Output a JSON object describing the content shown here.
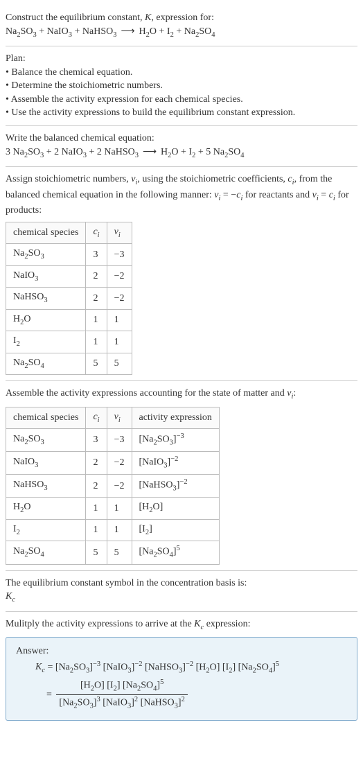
{
  "intro": {
    "line1": "Construct the equilibrium constant, K, expression for:",
    "equation": "Na₂SO₃ + NaIO₃ + NaHSO₃  ⟶  H₂O + I₂ + Na₂SO₄"
  },
  "plan": {
    "heading": "Plan:",
    "items": [
      "Balance the chemical equation.",
      "Determine the stoichiometric numbers.",
      "Assemble the activity expression for each chemical species.",
      "Use the activity expressions to build the equilibrium constant expression."
    ]
  },
  "balanced": {
    "line1": "Write the balanced chemical equation:",
    "equation": "3 Na₂SO₃ + 2 NaIO₃ + 2 NaHSO₃  ⟶  H₂O + I₂ + 5 Na₂SO₄"
  },
  "stoich": {
    "text": "Assign stoichiometric numbers, νᵢ, using the stoichiometric coefficients, cᵢ, from the balanced chemical equation in the following manner: νᵢ = −cᵢ for reactants and νᵢ = cᵢ for products:",
    "headers": [
      "chemical species",
      "cᵢ",
      "νᵢ"
    ],
    "rows": [
      {
        "sp": "Na₂SO₃",
        "c": "3",
        "nu": "−3"
      },
      {
        "sp": "NaIO₃",
        "c": "2",
        "nu": "−2"
      },
      {
        "sp": "NaHSO₃",
        "c": "2",
        "nu": "−2"
      },
      {
        "sp": "H₂O",
        "c": "1",
        "nu": "1"
      },
      {
        "sp": "I₂",
        "c": "1",
        "nu": "1"
      },
      {
        "sp": "Na₂SO₄",
        "c": "5",
        "nu": "5"
      }
    ]
  },
  "activity": {
    "text": "Assemble the activity expressions accounting for the state of matter and νᵢ:",
    "headers": [
      "chemical species",
      "cᵢ",
      "νᵢ",
      "activity expression"
    ],
    "rows": [
      {
        "sp": "Na₂SO₃",
        "c": "3",
        "nu": "−3",
        "ae": "[Na₂SO₃]⁻³"
      },
      {
        "sp": "NaIO₃",
        "c": "2",
        "nu": "−2",
        "ae": "[NaIO₃]⁻²"
      },
      {
        "sp": "NaHSO₃",
        "c": "2",
        "nu": "−2",
        "ae": "[NaHSO₃]⁻²"
      },
      {
        "sp": "H₂O",
        "c": "1",
        "nu": "1",
        "ae": "[H₂O]"
      },
      {
        "sp": "I₂",
        "c": "1",
        "nu": "1",
        "ae": "[I₂]"
      },
      {
        "sp": "Na₂SO₄",
        "c": "5",
        "nu": "5",
        "ae": "[Na₂SO₄]⁵"
      }
    ]
  },
  "symbol": {
    "line1": "The equilibrium constant symbol in the concentration basis is:",
    "line2": "K_c"
  },
  "multiply": {
    "text": "Mulitply the activity expressions to arrive at the K_c expression:"
  },
  "answer": {
    "label": "Answer:",
    "eq_flat": "K_c = [Na₂SO₃]⁻³ [NaIO₃]⁻² [NaHSO₃]⁻² [H₂O] [I₂] [Na₂SO₄]⁵",
    "frac_num": "[H₂O] [I₂] [Na₂SO₄]⁵",
    "frac_den": "[Na₂SO₃]³ [NaIO₃]² [NaHSO₃]²"
  },
  "chart_data": {
    "type": "table",
    "tables": [
      {
        "title": "Stoichiometric numbers",
        "columns": [
          "chemical species",
          "c_i",
          "nu_i"
        ],
        "rows": [
          [
            "Na2SO3",
            3,
            -3
          ],
          [
            "NaIO3",
            2,
            -2
          ],
          [
            "NaHSO3",
            2,
            -2
          ],
          [
            "H2O",
            1,
            1
          ],
          [
            "I2",
            1,
            1
          ],
          [
            "Na2SO4",
            5,
            5
          ]
        ]
      },
      {
        "title": "Activity expressions",
        "columns": [
          "chemical species",
          "c_i",
          "nu_i",
          "activity expression"
        ],
        "rows": [
          [
            "Na2SO3",
            3,
            -3,
            "[Na2SO3]^-3"
          ],
          [
            "NaIO3",
            2,
            -2,
            "[NaIO3]^-2"
          ],
          [
            "NaHSO3",
            2,
            -2,
            "[NaHSO3]^-2"
          ],
          [
            "H2O",
            1,
            1,
            "[H2O]"
          ],
          [
            "I2",
            1,
            1,
            "[I2]"
          ],
          [
            "Na2SO4",
            5,
            5,
            "[Na2SO4]^5"
          ]
        ]
      }
    ]
  }
}
